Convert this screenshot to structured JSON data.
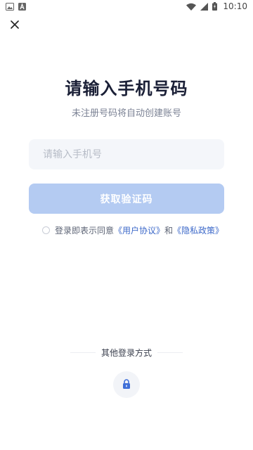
{
  "status_bar": {
    "time": "10:10",
    "left_icons": [
      "image-icon",
      "a-notification-icon"
    ],
    "right_icons": [
      "wifi-icon",
      "signal-icon",
      "battery-icon"
    ]
  },
  "header": {
    "close_icon": "close-icon"
  },
  "login": {
    "title": "请输入手机号码",
    "subtitle": "未注册号码将自动创建账号",
    "phone_placeholder": "请输入手机号",
    "phone_value": "",
    "get_code_label": "获取验证码",
    "agreement_prefix": "登录即表示同意",
    "user_agreement": "《用户协议》",
    "agreement_and": "和",
    "privacy_policy": "《隐私政策》",
    "agreement_checked": false
  },
  "other_methods": {
    "label": "其他登录方式",
    "methods": [
      "lock-icon"
    ]
  },
  "colors": {
    "title": "#1a1f36",
    "button_disabled": "#b4cbf2",
    "link": "#3d69c9",
    "input_bg": "#f4f6fa",
    "lock": "#3f6fd8"
  }
}
